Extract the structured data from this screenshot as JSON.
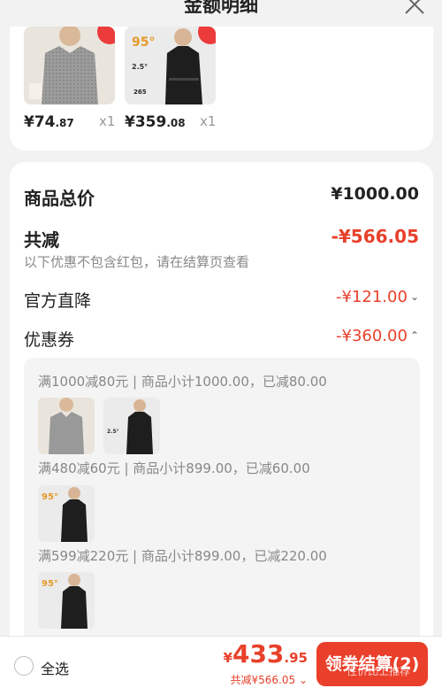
{
  "header": {
    "title": "金额明细"
  },
  "products": [
    {
      "price_int": "¥74",
      "price_dec": ".87",
      "qty": "x1",
      "badge": ""
    },
    {
      "price_int": "¥359",
      "price_dec": ".08",
      "qty": "x1",
      "badge": "95°"
    }
  ],
  "summary": {
    "total_label": "商品总价",
    "total_value": "¥1000.00",
    "discount_label": "共减",
    "discount_value": "-¥566.05",
    "discount_note": "以下优惠不包含红包，请在结算页查看",
    "direct_label": "官方直降",
    "direct_value": "-¥121.00",
    "coupon_label": "优惠券",
    "coupon_value": "-¥360.00"
  },
  "coupons": [
    {
      "text": "满1000减80元 | 商品小计1000.00，已减80.00"
    },
    {
      "text": "满480减60元 | 商品小计899.00，已减60.00"
    },
    {
      "text": "满599减220元 | 商品小计899.00，已减220.00"
    }
  ],
  "bottom": {
    "select_all": "全选",
    "currency": "¥",
    "total_int": "433",
    "total_dec": ".95",
    "saved": "共减¥566.05",
    "checkout": "领券结算(2)",
    "watermark": "性价比上推荐"
  },
  "colors": {
    "accent": "#e8412b",
    "button": "#ea3f2a",
    "background": "#f2f2f2"
  }
}
